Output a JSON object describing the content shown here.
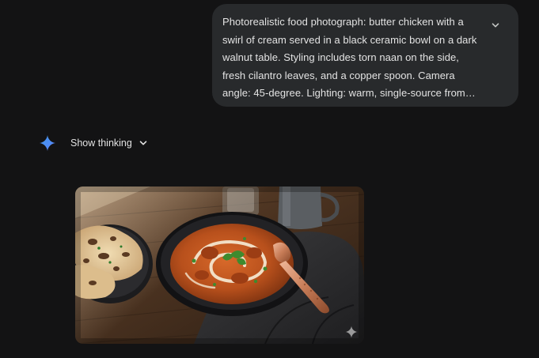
{
  "user_prompt": {
    "text": "Photorealistic food photograph: butter chicken with a swirl of cream served in a black ceramic bowl on a dark walnut table. Styling includes torn naan on the side, fresh cilantro leaves, and a copper spoon. Camera angle: 45-degree. Lighting: warm, single-source from…",
    "expand_icon": "chevron-down-icon"
  },
  "response": {
    "logo_icon": "sparkle-icon",
    "show_thinking_label": "Show thinking",
    "show_thinking_icon": "chevron-down-icon",
    "image": {
      "alt": "Butter chicken with a swirl of cream in a black bowl, naan on the side, copper spoon, on a wooden table",
      "watermark_icon": "sparkle-icon"
    }
  },
  "colors": {
    "background": "#131314",
    "bubble": "#282a2c",
    "text": "#e3e3e3",
    "accent_blue": "#4c8df6"
  }
}
